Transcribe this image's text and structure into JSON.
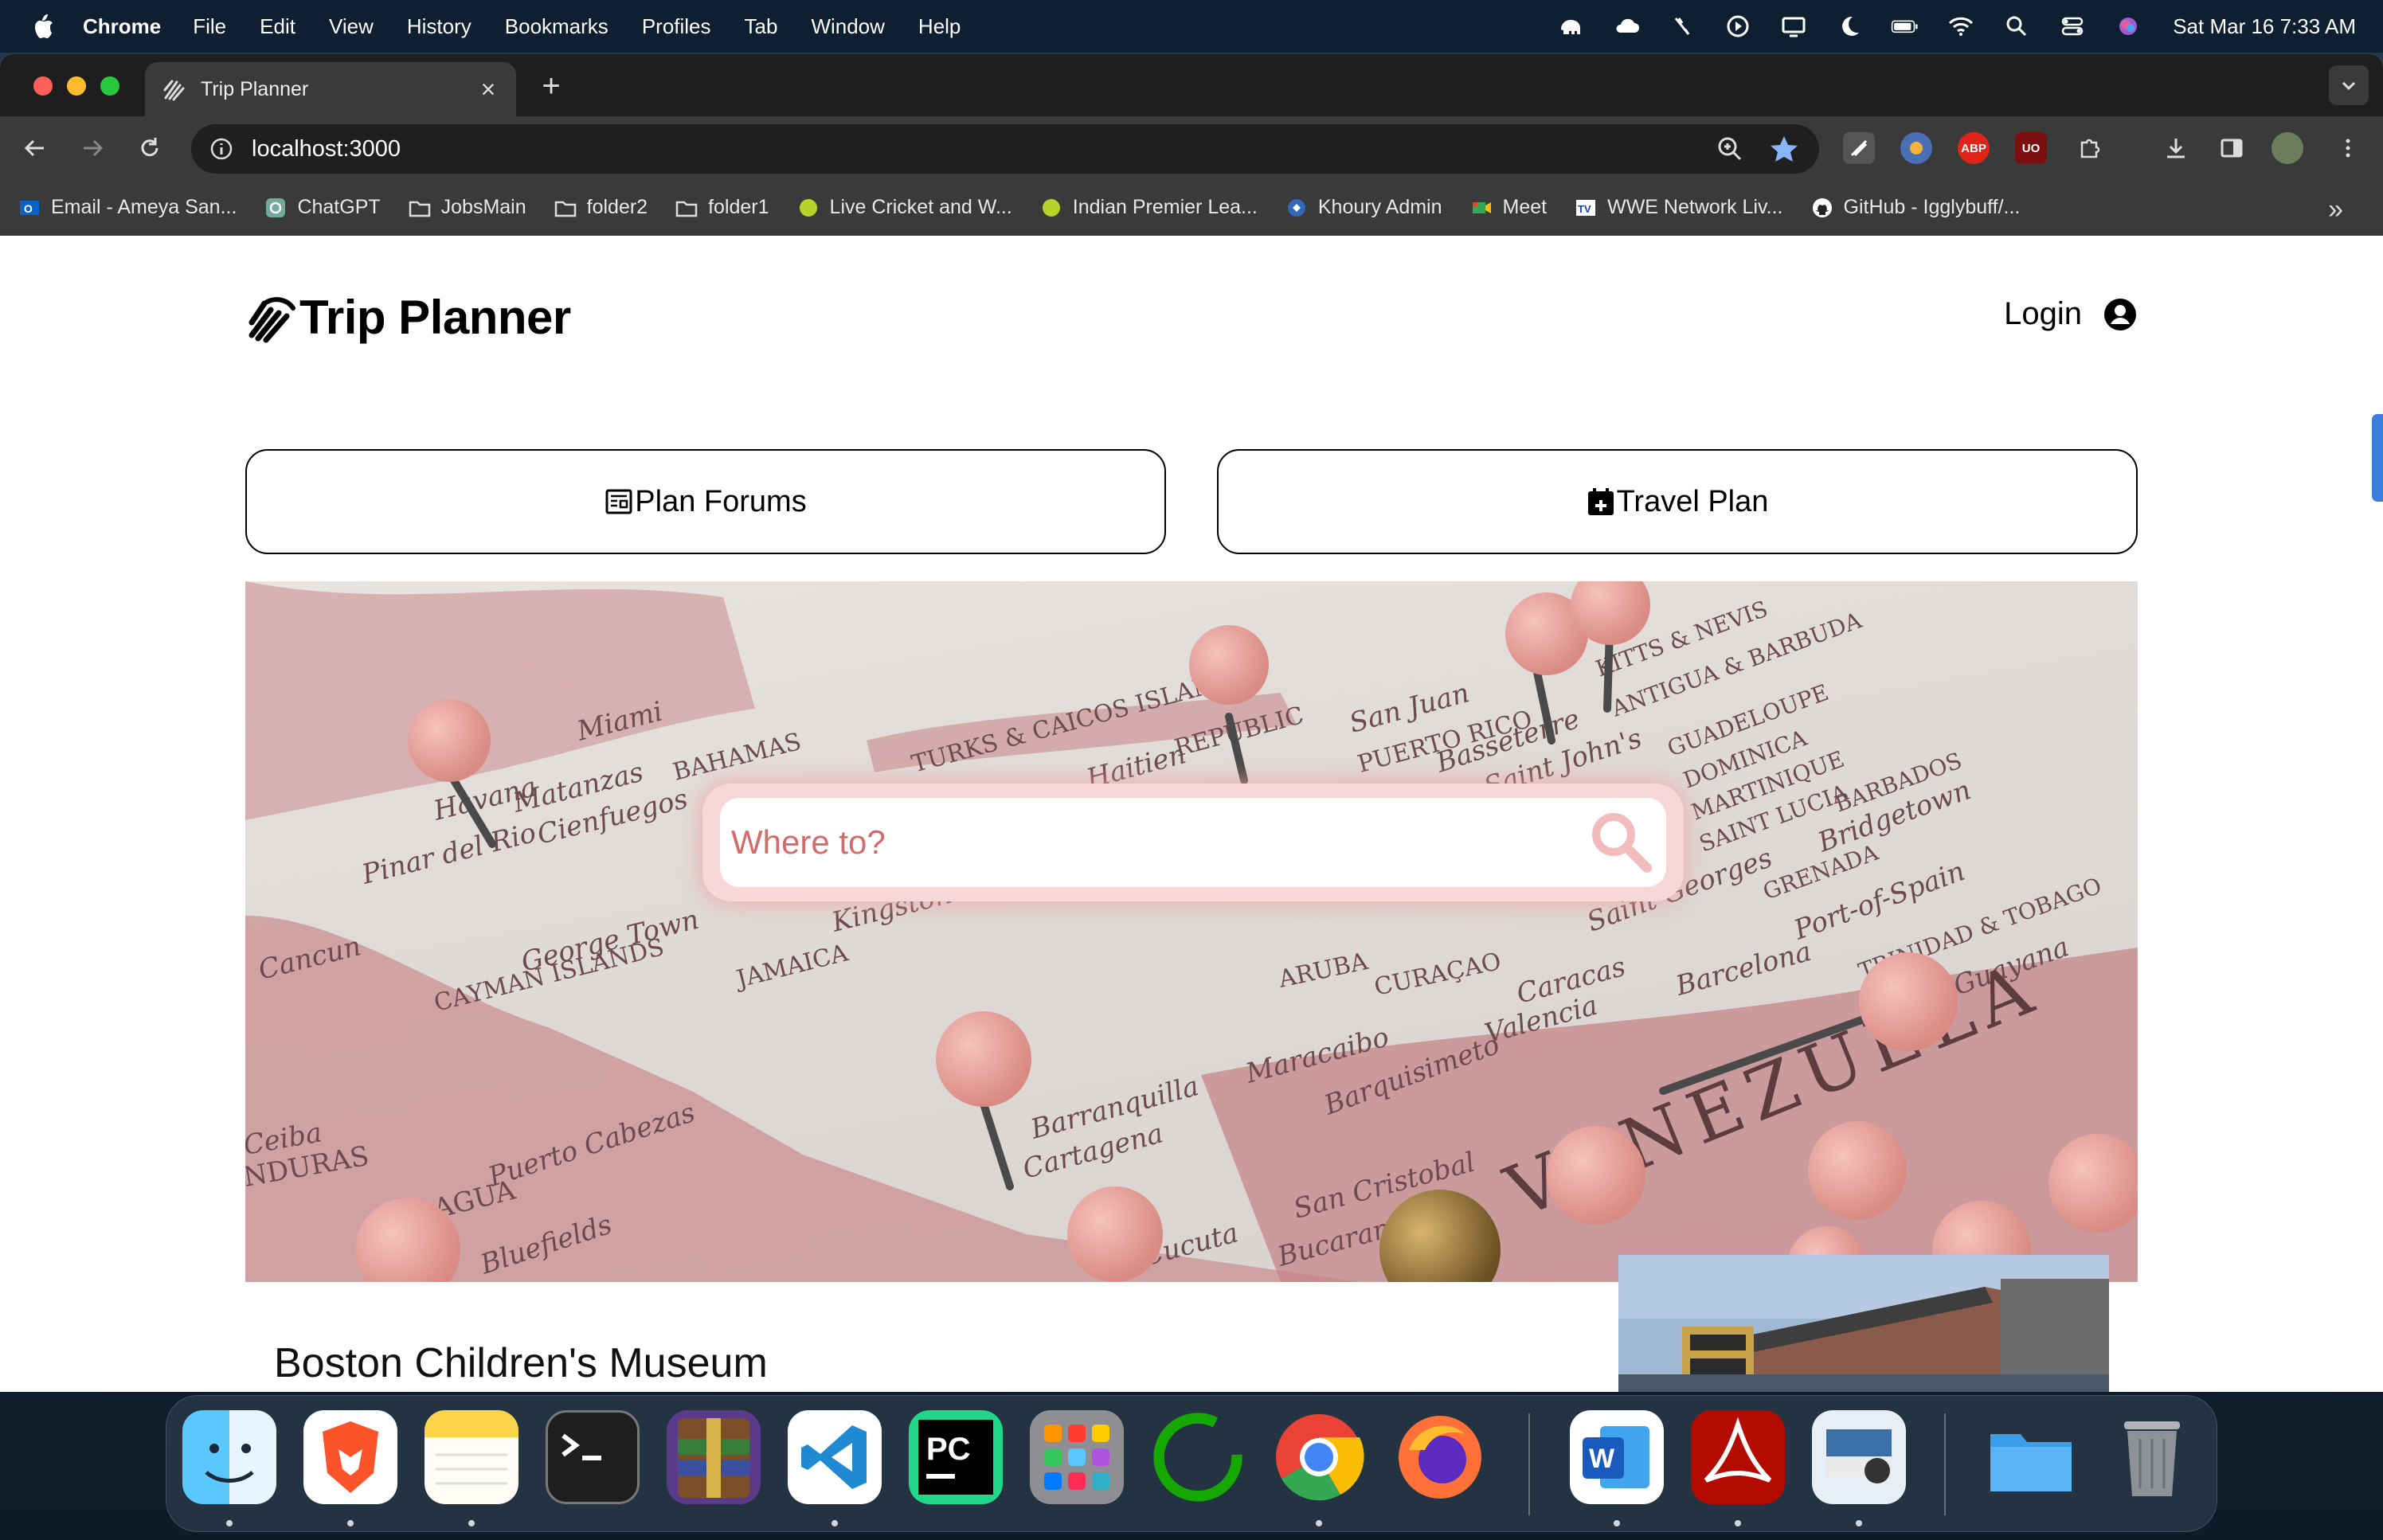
{
  "menubar": {
    "app": "Chrome",
    "items": [
      "File",
      "Edit",
      "View",
      "History",
      "Bookmarks",
      "Profiles",
      "Tab",
      "Window",
      "Help"
    ],
    "clock": "Sat Mar 16  7:33 AM"
  },
  "browser": {
    "tab_title": "Trip Planner",
    "url": "localhost:3000",
    "bookmarks": [
      {
        "label": "Email - Ameya San...",
        "icon": "outlook-icon"
      },
      {
        "label": "ChatGPT",
        "icon": "chatgpt-icon"
      },
      {
        "label": "JobsMain",
        "icon": "folder-icon"
      },
      {
        "label": "folder2",
        "icon": "folder-icon"
      },
      {
        "label": "folder1",
        "icon": "folder-icon"
      },
      {
        "label": "Live Cricket and W...",
        "icon": "cricket-ball-icon"
      },
      {
        "label": "Indian Premier Lea...",
        "icon": "cricket-ball-icon"
      },
      {
        "label": "Khoury Admin",
        "icon": "khoury-icon"
      },
      {
        "label": "Meet",
        "icon": "meet-icon"
      },
      {
        "label": "WWE Network Liv...",
        "icon": "tv-icon"
      },
      {
        "label": "GitHub - Igglybuff/...",
        "icon": "github-icon"
      }
    ],
    "extensions": [
      "ABP",
      "UO"
    ]
  },
  "site": {
    "brand": "Trip Planner",
    "login_label": "Login",
    "buttons": {
      "forums": "Plan Forums",
      "travel": "Travel Plan"
    },
    "search": {
      "placeholder": "Where to?"
    },
    "hero_map_labels": [
      "TURKS & CAICOS ISLANDS",
      "BAHAMAS",
      "Miami",
      "Havana",
      "Matanzas",
      "Cienfuegos",
      "Pinar del Rio",
      "George Town",
      "CAYMAN ISLANDS",
      "JAMAICA",
      "Kingston",
      "Cancun",
      "Haitien",
      "REPUBLIC",
      "San Juan",
      "PUERTO RICO",
      "Basseterre",
      "Saint John's",
      "KITTS & NEVIS",
      "ANTIGUA & BARBUDA",
      "GUADELOUPE",
      "DOMINICA",
      "MARTINIQUE",
      "SAINT LUCIA",
      "BARBADOS",
      "Bridgetown",
      "GRENADA",
      "Saint Georges",
      "Port-of-Spain",
      "TRINIDAD & TOBAGO",
      "ARUBA",
      "CURAÇAO",
      "Caracas",
      "Valencia",
      "Barcelona",
      "Guayana",
      "Barquisimeto",
      "Maracaibo",
      "Barranquilla",
      "Cartagena",
      "VENEZUELA",
      "San Cristobal",
      "Cucuta",
      "Bucaramanga",
      "Puerto Cabezas",
      "Bluefields",
      "AGUA",
      "NDURAS",
      "Ceiba"
    ],
    "card": {
      "title": "Boston Children's Museum"
    }
  },
  "dock": {
    "apps": [
      "Finder",
      "Brave",
      "Notes",
      "Terminal",
      "UnRAR",
      "Visual Studio Code",
      "PyCharm",
      "Launchpad",
      "Upwork",
      "Chrome",
      "Firefox",
      "Word",
      "Acrobat",
      "Preview",
      "Folder",
      "Trash"
    ]
  },
  "colors": {
    "accent_pink": "#d46a6a",
    "menubar": "#0d1f31",
    "chrome_toolbar": "#3a3a3a"
  }
}
